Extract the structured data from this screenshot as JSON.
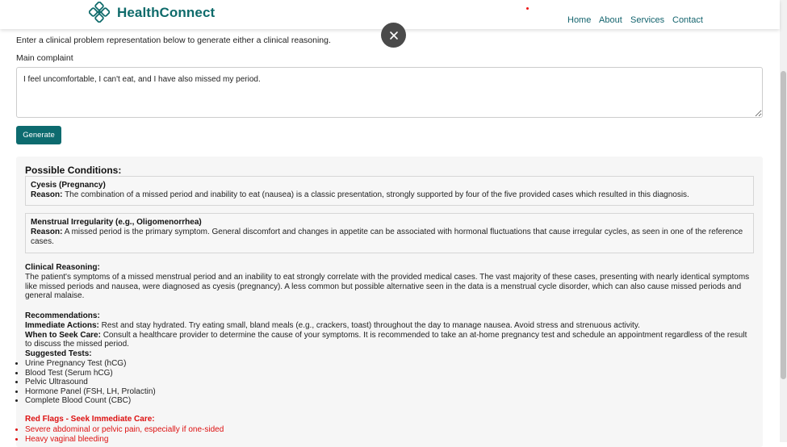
{
  "header": {
    "brand": "HealthConnect",
    "nav": [
      "Home",
      "About",
      "Services",
      "Contact"
    ],
    "accent": "#0f6b6b"
  },
  "intro": "Enter a clinical problem representation below to generate either a clinical reasoning.",
  "complaint": {
    "label": "Main complaint",
    "value": "I feel uncomfortable, I can't eat, and I have also missed my period."
  },
  "generate_label": "Generate",
  "result": {
    "title": "Possible Conditions:",
    "conditions": [
      {
        "name": "Cyesis (Pregnancy)",
        "reason_label": "Reason:",
        "reason": "The combination of a missed period and inability to eat (nausea) is a classic presentation, strongly supported by four of the five provided cases which resulted in this diagnosis."
      },
      {
        "name": "Menstrual Irregularity (e.g., Oligomenorrhea)",
        "reason_label": "Reason:",
        "reason": "A missed period is the primary symptom. General discomfort and changes in appetite can be associated with hormonal fluctuations that cause irregular cycles, as seen in one of the reference cases."
      }
    ],
    "clinical_reasoning_label": "Clinical Reasoning:",
    "clinical_reasoning": "The patient's symptoms of a missed menstrual period and an inability to eat strongly correlate with the provided medical cases. The vast majority of these cases, presenting with nearly identical symptoms like missed periods and nausea, were diagnosed as cyesis (pregnancy). A less common but possible alternative seen in the data is a menstrual cycle disorder, which can also cause missed periods and general malaise.",
    "recommendations_label": "Recommendations:",
    "immediate_label": "Immediate Actions:",
    "immediate": "Rest and stay hydrated. Try eating small, bland meals (e.g., crackers, toast) throughout the day to manage nausea. Avoid stress and strenuous activity.",
    "seek_care_label": "When to Seek Care:",
    "seek_care": "Consult a healthcare provider to determine the cause of your symptoms. It is recommended to take an at-home pregnancy test and schedule an appointment regardless of the result to discuss the missed period.",
    "tests_label": "Suggested Tests:",
    "tests": [
      "Urine Pregnancy Test (hCG)",
      "Blood Test (Serum hCG)",
      "Pelvic Ultrasound",
      "Hormone Panel (FSH, LH, Prolactin)",
      "Complete Blood Count (CBC)"
    ],
    "red_flags_label": "Red Flags - Seek Immediate Care:",
    "red_flags": [
      "Severe abdominal or pelvic pain, especially if one-sided",
      "Heavy vaginal bleeding"
    ],
    "red_color": "#dd1111"
  }
}
